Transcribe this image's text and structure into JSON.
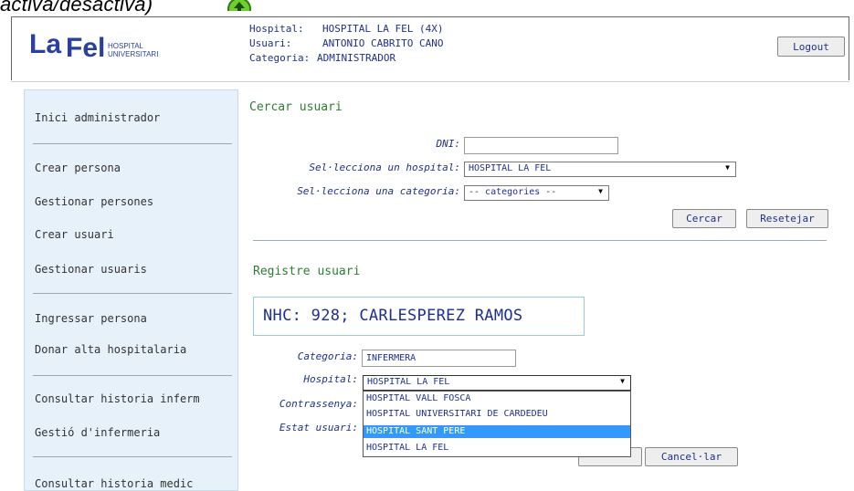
{
  "caption": {
    "text": "activa/desactiva)"
  },
  "header": {
    "logo_main": "La Fel",
    "logo_sub1": "HOSPITAL",
    "logo_sub2": "UNIVERSITARI",
    "hospital_label": "Hospital:",
    "hospital_value": "HOSPITAL LA FEL (4X)",
    "user_label": "Usuari:",
    "user_value": "ANTONIO CABRITO CANO",
    "category_label": "Categoria:",
    "category_value": "ADMINISTRADOR",
    "logout_label": "Logout"
  },
  "sidebar": {
    "items": [
      "Inici administrador",
      "Crear persona",
      "Gestionar persones",
      "Crear usuari",
      "Gestionar usuaris",
      "Ingressar persona",
      "Donar alta hospitalaria",
      "Consultar historia inferm",
      "Gestió d'infermeria",
      "Consultar historia medic"
    ]
  },
  "search": {
    "title": "Cercar usuari",
    "dni_label": "DNI:",
    "dni_value": "",
    "hospital_label": "Sel·lecciona un hospital:",
    "hospital_value": "HOSPITAL LA FEL",
    "category_label": "Sel·lecciona una categoria:",
    "category_value": "-- categories --",
    "search_button": "Cercar",
    "reset_button": "Resetejar"
  },
  "register": {
    "title": "Registre usuari",
    "nhc_text": "NHC: 928; CARLESPEREZ RAMOS",
    "category_label": "Categoria:",
    "category_value": "INFERMERA",
    "hospital_label": "Hospital:",
    "hospital_value": "HOSPITAL LA FEL",
    "password_label": "Contrassenya:",
    "status_label": "Estat usuari:",
    "cancel_button": "Cancel·lar",
    "hospital_options": [
      "HOSPITAL VALL FOSCA",
      "HOSPITAL UNIVERSITARI DE CARDEDEU",
      "HOSPITAL SANT PERE",
      "HOSPITAL LA FEL"
    ],
    "highlighted_option": "HOSPITAL SANT PERE"
  },
  "colors": {
    "text_blue": "#1f2f8f",
    "title_green": "#2e7d32",
    "sidebar_bg": "#e6f1fa",
    "highlight": "#3399ff"
  }
}
